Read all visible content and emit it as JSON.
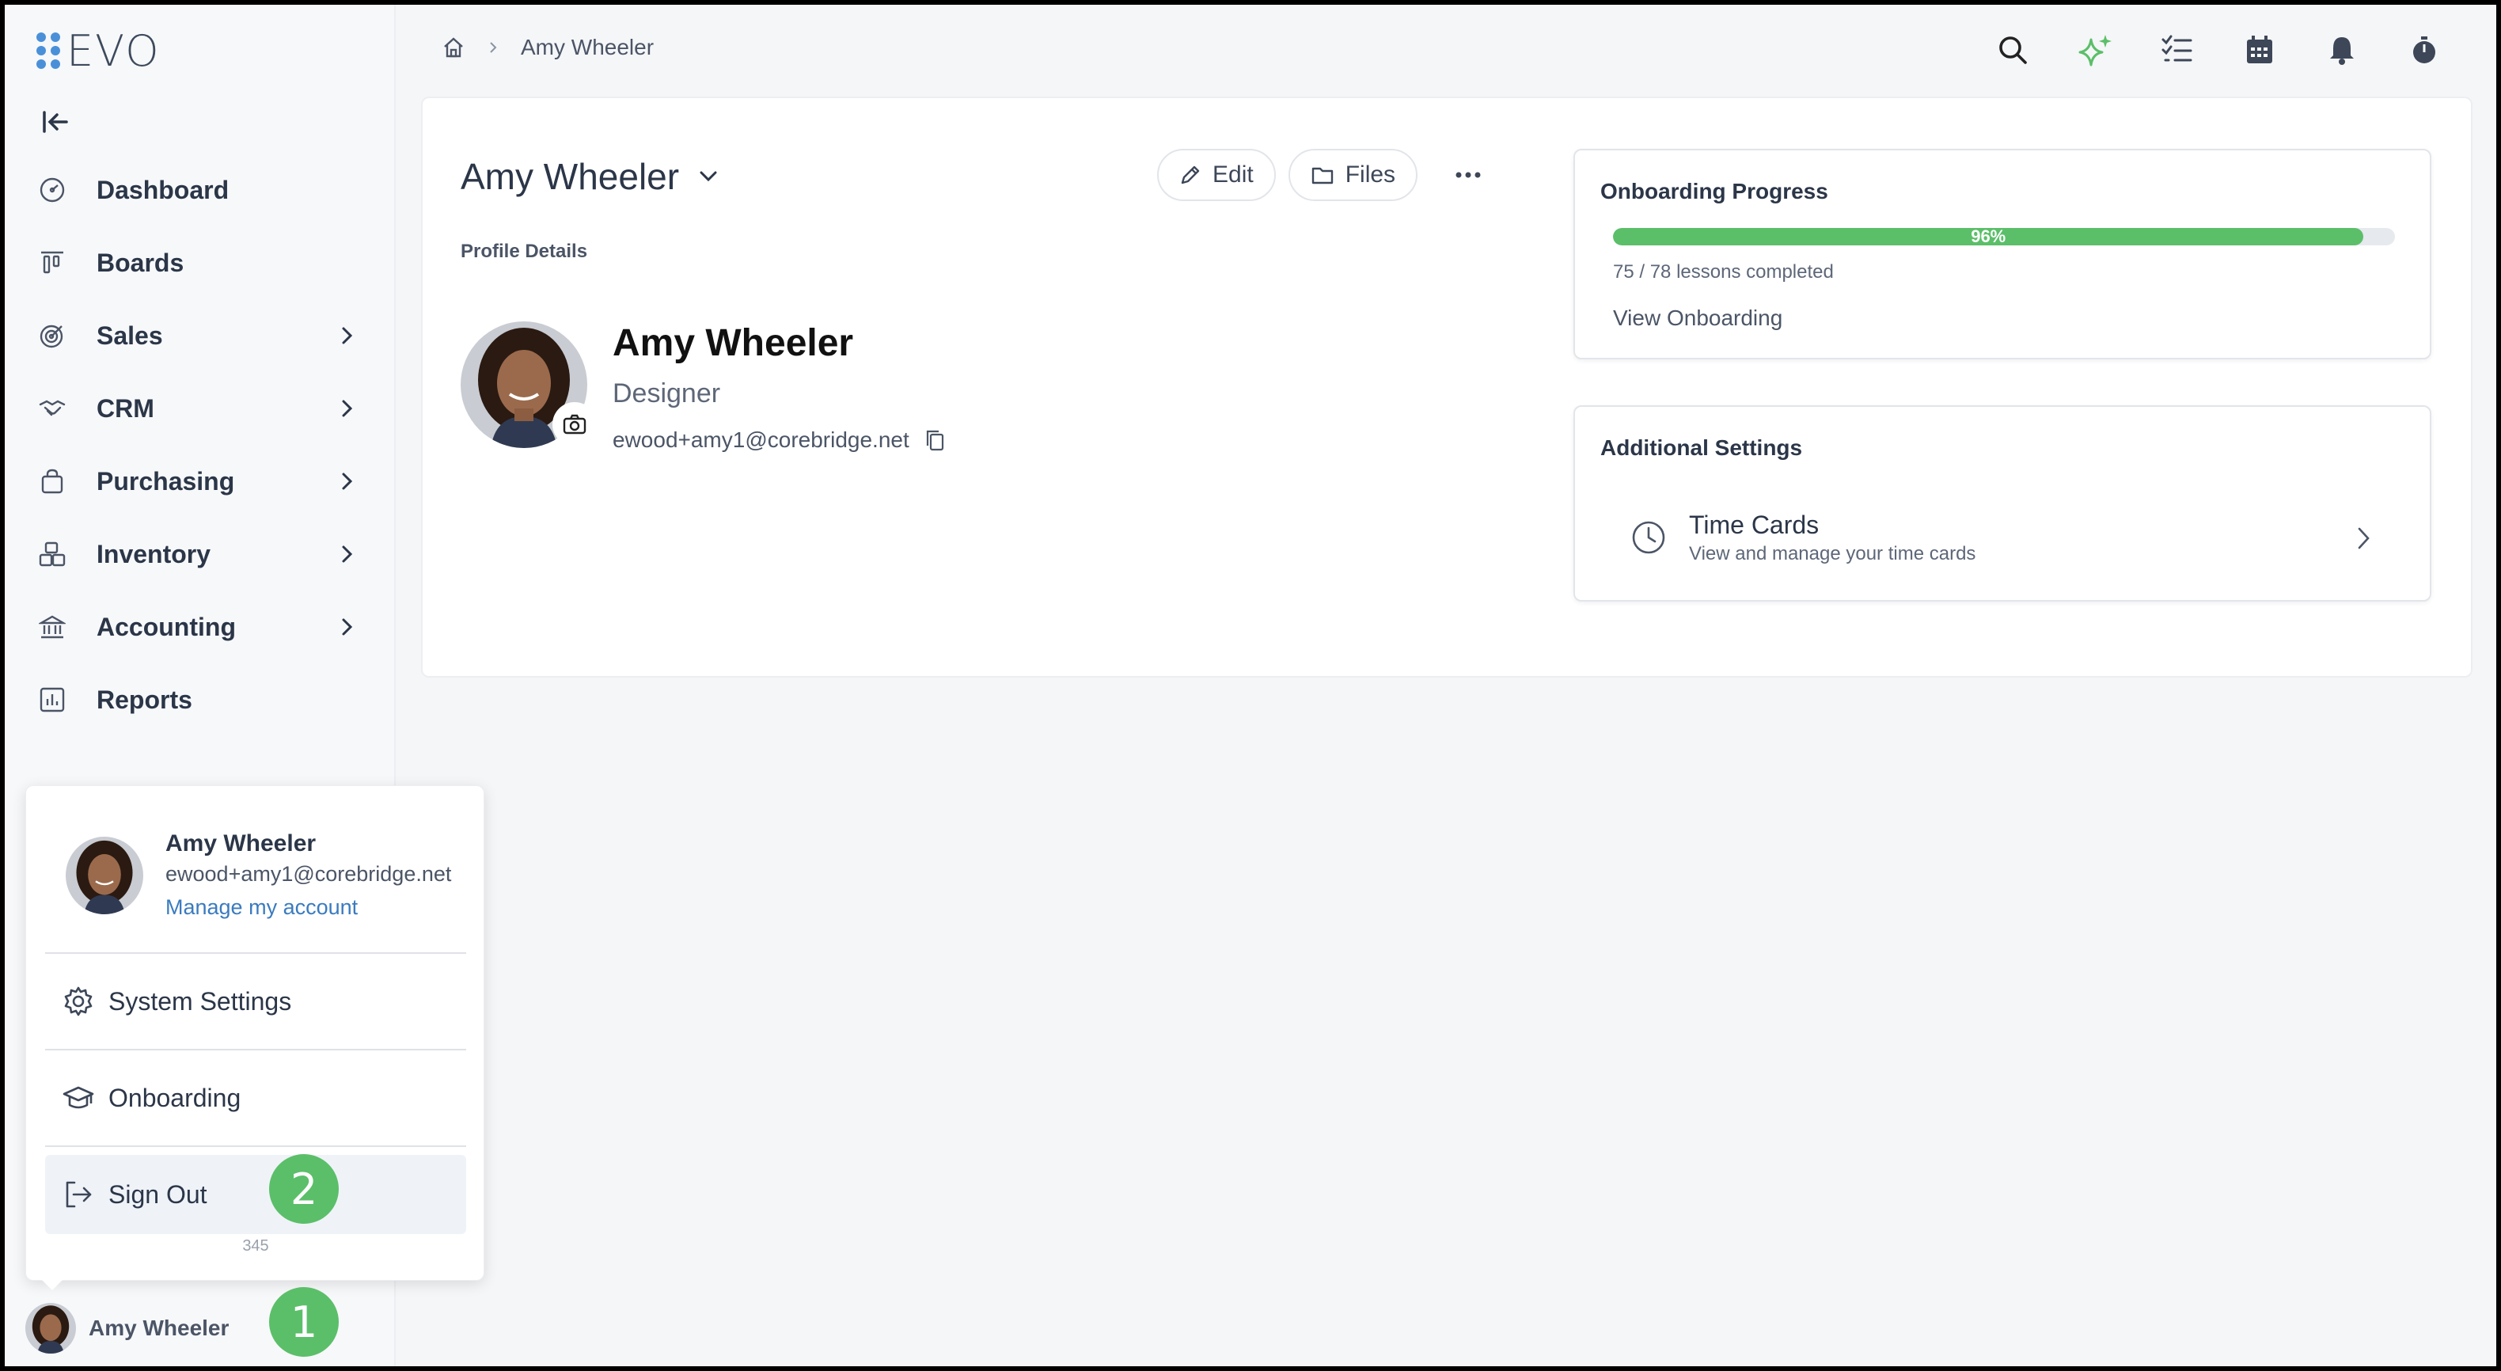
{
  "app": {
    "logo_text": "EVO"
  },
  "sidebar": {
    "items": [
      {
        "label": "Dashboard",
        "icon": "dashboard-icon",
        "has_submenu": false
      },
      {
        "label": "Boards",
        "icon": "boards-icon",
        "has_submenu": false
      },
      {
        "label": "Sales",
        "icon": "target-icon",
        "has_submenu": true
      },
      {
        "label": "CRM",
        "icon": "handshake-icon",
        "has_submenu": true
      },
      {
        "label": "Purchasing",
        "icon": "shopping-bag-icon",
        "has_submenu": true
      },
      {
        "label": "Inventory",
        "icon": "boxes-icon",
        "has_submenu": true
      },
      {
        "label": "Accounting",
        "icon": "bank-icon",
        "has_submenu": true
      },
      {
        "label": "Reports",
        "icon": "bar-chart-icon",
        "has_submenu": false
      }
    ]
  },
  "breadcrumb": {
    "current": "Amy Wheeler"
  },
  "profile": {
    "name": "Amy Wheeler",
    "edit_label": "Edit",
    "files_label": "Files",
    "section_label": "Profile Details",
    "display_name": "Amy Wheeler",
    "role": "Designer",
    "email": "ewood+amy1@corebridge.net"
  },
  "onboarding": {
    "title": "Onboarding Progress",
    "percent": 96,
    "percent_label": "96%",
    "lessons": "75 / 78 lessons completed",
    "link": "View Onboarding"
  },
  "additional_settings": {
    "title": "Additional Settings",
    "time_cards_title": "Time Cards",
    "time_cards_sub": "View and manage your time cards"
  },
  "user_menu": {
    "name": "Amy Wheeler",
    "email": "ewood+amy1@corebridge.net",
    "manage": "Manage my account",
    "system_settings": "System Settings",
    "onboarding": "Onboarding",
    "sign_out": "Sign Out",
    "version": "345"
  },
  "footer_user": {
    "name": "Amy Wheeler"
  },
  "badges": {
    "one": "1",
    "two": "2"
  },
  "colors": {
    "accent_green": "#5bbf69",
    "link_blue": "#3a7bbf",
    "logo_blue": "#4a90d9"
  }
}
